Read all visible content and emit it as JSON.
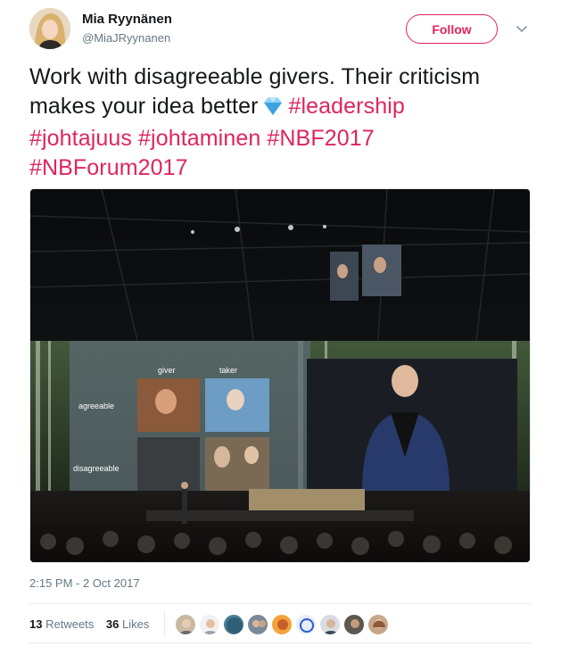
{
  "author": {
    "name": "Mia Ryynänen",
    "handle": "@MiaJRyynanen"
  },
  "follow_label": "Follow",
  "tweet": {
    "text": "Work with disagreeable givers. Their criticism makes your idea better",
    "hashtags": [
      "#leadership",
      "#johtajuus",
      "#johtaminen",
      "#NBF2017",
      "#NBForum2017"
    ]
  },
  "slide": {
    "col_giver": "giver",
    "col_taker": "taker",
    "row_agreeable": "agreeable",
    "row_disagreeable": "disagreeable"
  },
  "timestamp": "2:15 PM - 2 Oct 2017",
  "stats": {
    "retweets_count": "13",
    "retweets_label": "Retweets",
    "likes_count": "36",
    "likes_label": "Likes"
  },
  "colors": {
    "accent": "#e0245e",
    "secondary_text": "#657786"
  },
  "icons": [
    "caret-down-icon",
    "gem-stone-icon"
  ]
}
